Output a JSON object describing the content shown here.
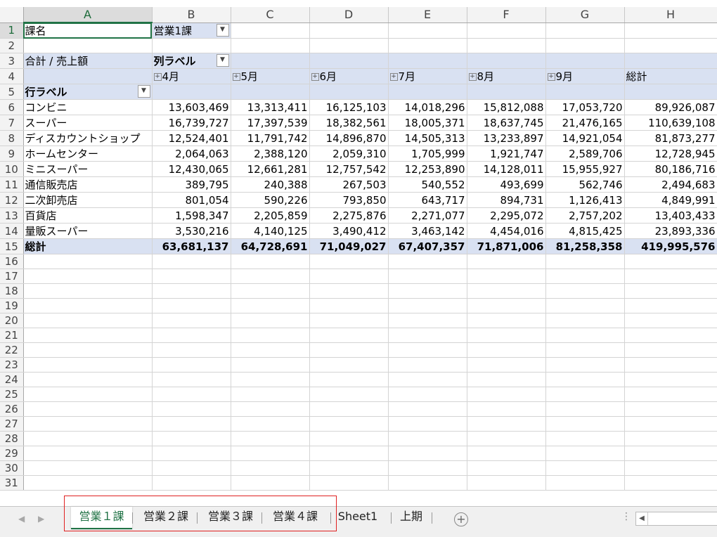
{
  "columns": [
    "A",
    "B",
    "C",
    "D",
    "E",
    "F",
    "G",
    "H"
  ],
  "filter": {
    "label": "課名",
    "value": "営業1課"
  },
  "pivot": {
    "value_label": "合計 / 売上額",
    "col_label": "列ラベル",
    "row_label": "行ラベル",
    "months": [
      "4月",
      "5月",
      "6月",
      "7月",
      "8月",
      "9月"
    ],
    "total_label": "総計",
    "rows": [
      {
        "name": "コンビニ",
        "values": [
          "13,603,469",
          "13,313,411",
          "16,125,103",
          "14,018,296",
          "15,812,088",
          "17,053,720",
          "89,926,087"
        ]
      },
      {
        "name": "スーパー",
        "values": [
          "16,739,727",
          "17,397,539",
          "18,382,561",
          "18,005,371",
          "18,637,745",
          "21,476,165",
          "110,639,108"
        ]
      },
      {
        "name": "ディスカウントショップ",
        "values": [
          "12,524,401",
          "11,791,742",
          "14,896,870",
          "14,505,313",
          "13,233,897",
          "14,921,054",
          "81,873,277"
        ]
      },
      {
        "name": "ホームセンター",
        "values": [
          "2,064,063",
          "2,388,120",
          "2,059,310",
          "1,705,999",
          "1,921,747",
          "2,589,706",
          "12,728,945"
        ]
      },
      {
        "name": "ミニスーパー",
        "values": [
          "12,430,065",
          "12,661,281",
          "12,757,542",
          "12,253,890",
          "14,128,011",
          "15,955,927",
          "80,186,716"
        ]
      },
      {
        "name": "通信販売店",
        "values": [
          "389,795",
          "240,388",
          "267,503",
          "540,552",
          "493,699",
          "562,746",
          "2,494,683"
        ]
      },
      {
        "name": "二次卸売店",
        "values": [
          "801,054",
          "590,226",
          "793,850",
          "643,717",
          "894,731",
          "1,126,413",
          "4,849,991"
        ]
      },
      {
        "name": "百貨店",
        "values": [
          "1,598,347",
          "2,205,859",
          "2,275,876",
          "2,271,077",
          "2,295,072",
          "2,757,202",
          "13,403,433"
        ]
      },
      {
        "name": "量販スーパー",
        "values": [
          "3,530,216",
          "4,140,125",
          "3,490,412",
          "3,463,142",
          "4,454,016",
          "4,815,425",
          "23,893,336"
        ]
      }
    ],
    "grand_total": [
      "63,681,137",
      "64,728,691",
      "71,049,027",
      "67,407,357",
      "71,871,006",
      "81,258,358",
      "419,995,576"
    ]
  },
  "row_numbers": [
    "1",
    "2",
    "3",
    "4",
    "5",
    "6",
    "7",
    "8",
    "9",
    "10",
    "11",
    "12",
    "13",
    "14",
    "15",
    "16",
    "17",
    "18",
    "19",
    "20",
    "21",
    "22",
    "23",
    "24",
    "25",
    "26",
    "27",
    "28",
    "29",
    "30",
    "31"
  ],
  "tabs": [
    "営業１課",
    "営業２課",
    "営業３課",
    "営業４課",
    "Sheet1",
    "上期"
  ],
  "active_tab": "営業１課"
}
